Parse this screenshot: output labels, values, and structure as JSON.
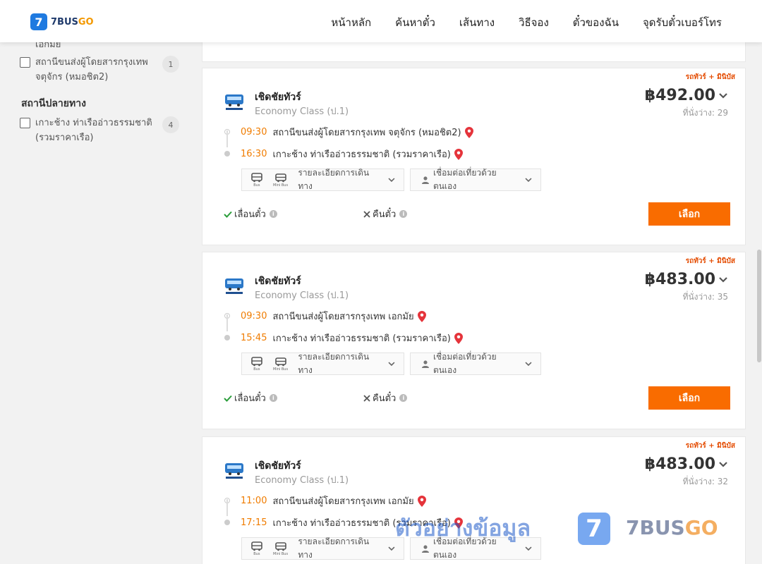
{
  "header": {
    "logo_mark": "7",
    "logo_text_main": "7BUS",
    "logo_text_accent": "GO",
    "nav": [
      "หน้าหลัก",
      "ค้นหาตั๋ว",
      "เส้นทาง",
      "วิธีจอง",
      "ตั๋วของฉัน",
      "จุดรับตั๋วเบอร์โทร"
    ]
  },
  "sidebar": {
    "cut_text": "เอกมัย",
    "origin_items": [
      {
        "label": "สถานีขนส่งผู้โดยสารกรุงเทพ จตุจักร (หมอชิต2)",
        "count": "1"
      }
    ],
    "destination_heading": "สถานีปลายทาง",
    "destination_items": [
      {
        "label": "เกาะช้าง ท่าเรืออ่าวธรรมชาติ (รวมราคาเรือ)",
        "count": "4"
      }
    ]
  },
  "trips": [
    {
      "tag": "รถทัวร์ + มินิบัส",
      "operator": "เชิดชัยทัวร์",
      "class": "Economy Class (ป.1)",
      "price": "฿492.00",
      "seats": "ที่นั่งว่าง: 29",
      "depart_time": "09:30",
      "depart_station": "สถานีขนส่งผู้โดยสารกรุงเทพ จตุจักร (หมอชิต2)",
      "arrive_time": "16:30",
      "arrive_station": "เกาะช้าง ท่าเรืออ่าวธรรมชาติ (รวมราคาเรือ)",
      "details_label": "รายละเอียดการเดินทาง",
      "connect_label": "เชื่อมต่อเที่ยวด้วยตนเอง",
      "vehicle_1": "Bus",
      "vehicle_2": "Mini Bus",
      "reschedule": "เลื่อนตั๋ว",
      "refund": "คืนตั๋ว",
      "select": "เลือก"
    },
    {
      "tag": "รถทัวร์ + มินิบัส",
      "operator": "เชิดชัยทัวร์",
      "class": "Economy Class (ป.1)",
      "price": "฿483.00",
      "seats": "ที่นั่งว่าง: 35",
      "depart_time": "09:30",
      "depart_station": "สถานีขนส่งผู้โดยสารกรุงเทพ เอกมัย",
      "arrive_time": "15:45",
      "arrive_station": "เกาะช้าง ท่าเรืออ่าวธรรมชาติ (รวมราคาเรือ)",
      "details_label": "รายละเอียดการเดินทาง",
      "connect_label": "เชื่อมต่อเที่ยวด้วยตนเอง",
      "vehicle_1": "Bus",
      "vehicle_2": "Mini Bus",
      "reschedule": "เลื่อนตั๋ว",
      "refund": "คืนตั๋ว",
      "select": "เลือก"
    },
    {
      "tag": "รถทัวร์ + มินิบัส",
      "operator": "เชิดชัยทัวร์",
      "class": "Economy Class (ป.1)",
      "price": "฿483.00",
      "seats": "ที่นั่งว่าง: 32",
      "depart_time": "11:00",
      "depart_station": "สถานีขนส่งผู้โดยสารกรุงเทพ เอกมัย",
      "arrive_time": "17:15",
      "arrive_station": "เกาะช้าง ท่าเรืออ่าวธรรมชาติ (รวมราคาเรือ)",
      "details_label": "รายละเอียดการเดินทาง",
      "connect_label": "เชื่อมต่อเที่ยวด้วยตนเอง",
      "vehicle_1": "Bus",
      "vehicle_2": "Mini Bus"
    }
  ],
  "watermark": {
    "text": "ตัวอย่างข้อมูล",
    "logo_mark": "7",
    "brand_main": "7BUS",
    "brand_accent": "GO"
  },
  "colors": {
    "accent_orange": "#f96c00",
    "time_orange": "#f07c00",
    "brand_blue": "#1f7ae0",
    "pin_red": "#e5343b"
  }
}
